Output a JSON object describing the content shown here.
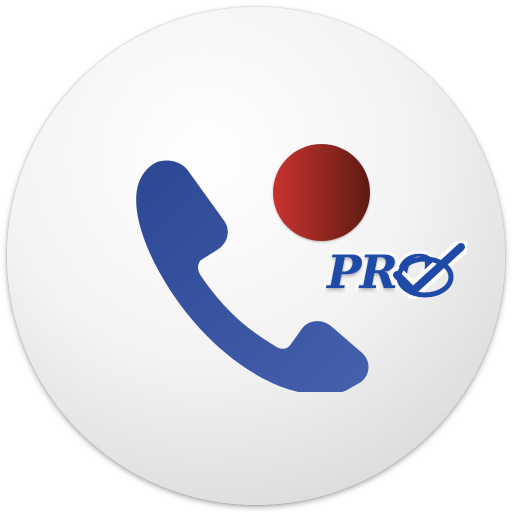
{
  "app_icon": {
    "name": "call-recorder-pro-icon",
    "badge_text": "PRO",
    "colors": {
      "phone": "#3a57a4",
      "record_dot_light": "#c83230",
      "record_dot_dark": "#5e1a14",
      "badge_text": "#1f4aa8",
      "background": "#eeeeee"
    },
    "icons": [
      "phone-handset-icon",
      "record-dot-icon",
      "checkmark-icon"
    ]
  }
}
